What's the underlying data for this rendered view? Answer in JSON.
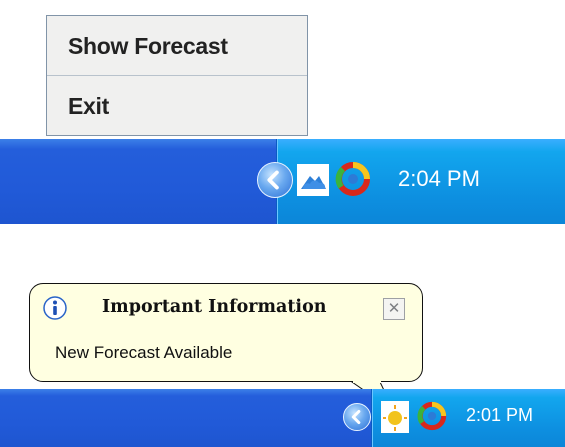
{
  "context_menu": {
    "items": [
      {
        "label": "Show Forecast"
      },
      {
        "label": "Exit"
      }
    ]
  },
  "taskbar_top": {
    "clock": "2:04 PM",
    "tray_icons": [
      "show-hidden-icons-chevron",
      "forecast-cloud-icon",
      "colorful-ring-icon"
    ]
  },
  "balloon": {
    "icon": "info-icon",
    "title": "Important Information",
    "message": "New Forecast Available",
    "close_glyph": "✕"
  },
  "taskbar_bottom": {
    "clock": "2:01 PM",
    "tray_icons": [
      "show-hidden-icons-chevron",
      "forecast-sun-icon",
      "colorful-ring-icon"
    ]
  },
  "colors": {
    "taskbar_blue": "#245edb",
    "tray_blue": "#0d8fe0",
    "menu_background": "#f0f0ef",
    "balloon_background": "#ffffe1"
  }
}
